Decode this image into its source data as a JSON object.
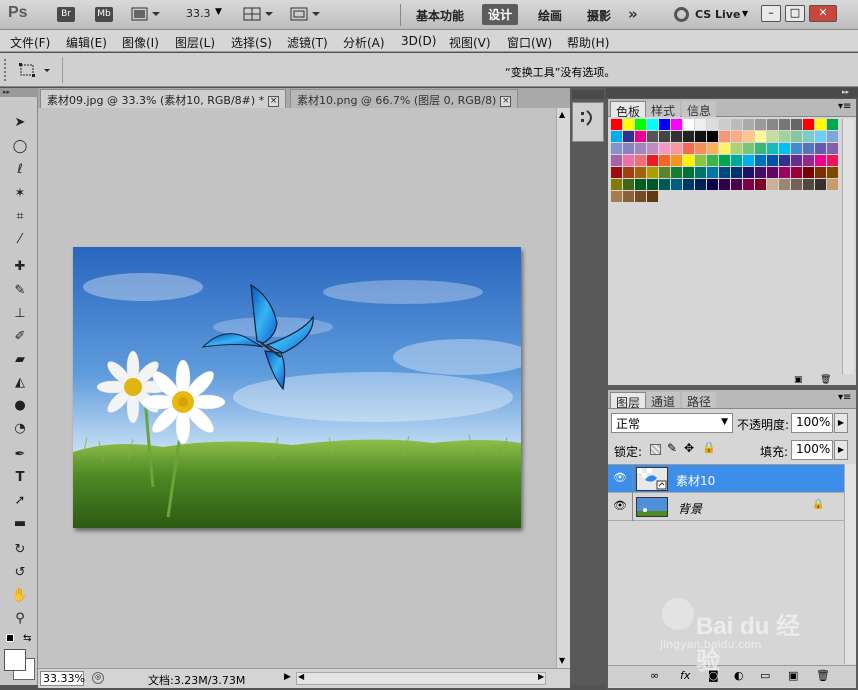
{
  "app": {
    "logo": "Ps",
    "bridge_label": "Br",
    "minibridge_label": "Mb",
    "zoom_value": "33.3",
    "workspaces": [
      "基本功能",
      "设计",
      "绘画",
      "摄影"
    ],
    "active_workspace": "设计",
    "more_label": "»",
    "cs_live": "CS Live",
    "window_buttons": [
      "–",
      "□",
      "✕"
    ]
  },
  "menu": [
    "文件(F)",
    "编辑(E)",
    "图像(I)",
    "图层(L)",
    "选择(S)",
    "滤镜(T)",
    "分析(A)",
    "3D(D)",
    "视图(V)",
    "窗口(W)",
    "帮助(H)"
  ],
  "options_bar": {
    "message": "“变换工具”没有选项。"
  },
  "document_tabs": [
    {
      "label": "素材09.jpg @ 33.3% (素材10, RGB/8#) *",
      "close": "×"
    },
    {
      "label": "素材10.png @ 66.7% (图层 0, RGB/8)",
      "close": "×"
    }
  ],
  "status_bar": {
    "zoom": "33.33%",
    "doc_info": "文档:3.23M/3.73M"
  },
  "swatches_panel": {
    "tabs": [
      "色板",
      "样式",
      "信息"
    ]
  },
  "swatch_colors": [
    "#ff0000",
    "#ffff00",
    "#00ff00",
    "#00ffff",
    "#0000ff",
    "#ff00ff",
    "#ffffff",
    "#eeeeee",
    "#dddddd",
    "#cccccc",
    "#bbbbbb",
    "#aaaaaa",
    "#999999",
    "#888888",
    "#777777",
    "#666666",
    "#ff0000",
    "#ffff00",
    "#00a651",
    "#00aeef",
    "#2e3192",
    "#ec008c",
    "#555555",
    "#444444",
    "#333333",
    "#222222",
    "#111111",
    "#000000",
    "#f7977a",
    "#f9ad81",
    "#fdc68a",
    "#fff79a",
    "#c4df9b",
    "#a3d39c",
    "#82ca9d",
    "#7bcdc8",
    "#6ecff6",
    "#7ea7d8",
    "#8493ca",
    "#8882be",
    "#a187be",
    "#bc8dbf",
    "#f49ac2",
    "#f6989d",
    "#f26c4f",
    "#f68e55",
    "#fbaf5c",
    "#fff467",
    "#acd372",
    "#7cc576",
    "#3bb878",
    "#1abbb4",
    "#00bff3",
    "#438ccb",
    "#5574b9",
    "#605ca8",
    "#855fa8",
    "#a763a8",
    "#f06ea9",
    "#f26d7d",
    "#ed1c24",
    "#f26522",
    "#f7941d",
    "#fff200",
    "#8dc63f",
    "#39b54a",
    "#00a651",
    "#00a99d",
    "#00aeef",
    "#0072bc",
    "#0054a6",
    "#2e3192",
    "#662d91",
    "#92278f",
    "#ec008c",
    "#ed145b",
    "#9e0b0f",
    "#a0410d",
    "#a3620a",
    "#aba000",
    "#598527",
    "#197b30",
    "#007236",
    "#00746b",
    "#0076a3",
    "#004a80",
    "#003471",
    "#1b1464",
    "#440e62",
    "#630460",
    "#9e005d",
    "#9e0039",
    "#790000",
    "#7b2e00",
    "#7d4900",
    "#827b00",
    "#406618",
    "#005e20",
    "#005826",
    "#005952",
    "#005b7f",
    "#003663",
    "#002157",
    "#0d004c",
    "#32004b",
    "#4b0049",
    "#7b0046",
    "#7a0026",
    "#c7b299",
    "#998675",
    "#736357",
    "#534741",
    "#37302d",
    "#c69c6d",
    "#a67c52",
    "#8c6239",
    "#754c24",
    "#603913"
  ],
  "layers_panel": {
    "tabs": [
      "图层",
      "通道",
      "路径"
    ],
    "blend_mode": "正常",
    "opacity_label": "不透明度:",
    "opacity_value": "100%",
    "lock_label": "锁定:",
    "fill_label": "填充:",
    "fill_value": "100%",
    "layers": [
      {
        "name": "素材10",
        "selected": true
      },
      {
        "name": "背景",
        "selected": false,
        "locked": true
      }
    ]
  },
  "watermark": {
    "brand": "Bai du 经验",
    "url": "jingyan.baidu.com"
  },
  "colors": {
    "accent_selected": "#3d8ee8",
    "sky_top": "#2f6fc4",
    "grass": "#5c9a2e",
    "butterfly": "#1f8fe0"
  }
}
